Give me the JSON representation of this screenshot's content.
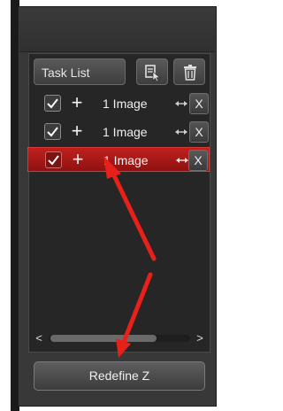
{
  "task_list": {
    "title": "Task List",
    "header_icons": [
      "clipboard-pointer-icon",
      "trash-icon"
    ],
    "rows": [
      {
        "checked": true,
        "plus": "+",
        "label": "1 Image",
        "remove": "X",
        "selected": false
      },
      {
        "checked": true,
        "plus": "+",
        "label": "1 Image",
        "remove": "X",
        "selected": false
      },
      {
        "checked": true,
        "plus": "+",
        "label": "1 Image",
        "remove": "X",
        "selected": true
      }
    ],
    "scroll_left": "<",
    "scroll_right": ">"
  },
  "actions": {
    "redefine_z": "Redefine Z"
  },
  "colors": {
    "selection": "#b01a18",
    "annotation_arrow": "#e8201a"
  }
}
